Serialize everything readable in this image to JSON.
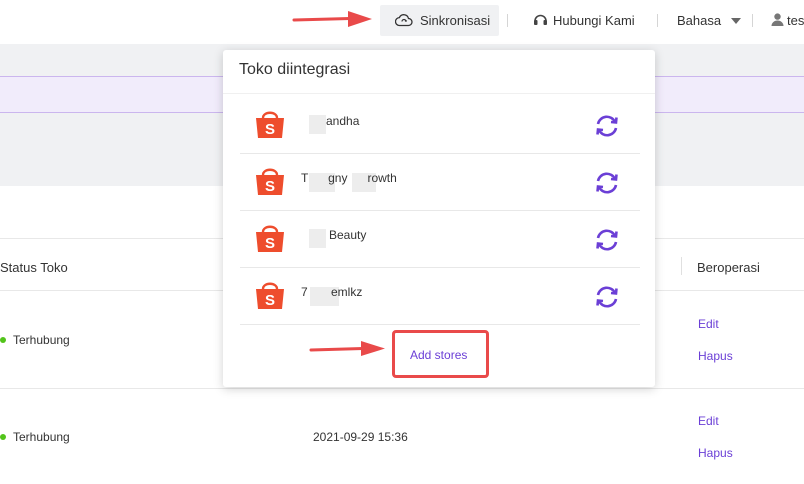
{
  "topbar": {
    "sync_label": "Sinkronisasi",
    "contact_label": "Hubungi Kami",
    "language_label": "Bahasa",
    "user_label": "tes"
  },
  "table": {
    "headers": {
      "status": "Status Toko",
      "operate": "Beroperasi"
    },
    "rows": [
      {
        "status": "Terhubung",
        "date": "",
        "edit": "Edit",
        "delete": "Hapus"
      },
      {
        "status": "Terhubung",
        "date": "2021-09-29 15:36",
        "edit": "Edit",
        "delete": "Hapus"
      }
    ]
  },
  "dropdown": {
    "title": "Toko diintegrasi",
    "stores": [
      {
        "name": "andha"
      },
      {
        "name": "T      gny      rowth"
      },
      {
        "name": "   Beauty"
      },
      {
        "name": "7       emlkz"
      }
    ],
    "add_label": "Add stores"
  },
  "colors": {
    "accent": "#6b3fd6",
    "shopee": "#ee4d2d",
    "arrow": "#e94a4a",
    "connected": "#52c41a"
  }
}
